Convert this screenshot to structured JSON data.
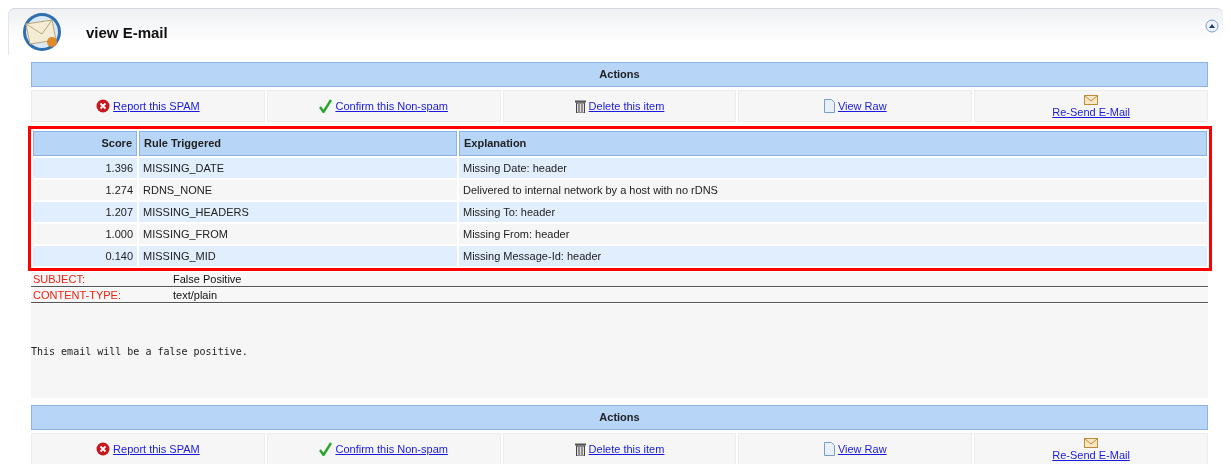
{
  "header": {
    "title": "view E-mail"
  },
  "actions_top": {
    "title": "Actions",
    "items": [
      {
        "kind": "report",
        "label": "Report this SPAM"
      },
      {
        "kind": "confirm",
        "label": "Confirm this Non-spam"
      },
      {
        "kind": "delete",
        "label": "Delete this item"
      },
      {
        "kind": "raw",
        "label": "View Raw"
      },
      {
        "kind": "resend",
        "label": "Re-Send E-Mail"
      }
    ]
  },
  "rules_table": {
    "highlighted": true,
    "columns": [
      "Score",
      "Rule Triggered",
      "Explanation"
    ],
    "rows": [
      {
        "score": "1.396",
        "rule": "MISSING_DATE",
        "explanation": "Missing Date: header"
      },
      {
        "score": "1.274",
        "rule": "RDNS_NONE",
        "explanation": "Delivered to internal network by a host with no rDNS"
      },
      {
        "score": "1.207",
        "rule": "MISSING_HEADERS",
        "explanation": "Missing To: header"
      },
      {
        "score": "1.000",
        "rule": "MISSING_FROM",
        "explanation": "Missing From: header"
      },
      {
        "score": "0.140",
        "rule": "MISSING_MID",
        "explanation": "Missing Message-Id: header"
      }
    ]
  },
  "headers": [
    {
      "name": "SUBJECT:",
      "value": "False Positive"
    },
    {
      "name": "CONTENT-TYPE:",
      "value": "text/plain"
    }
  ],
  "body": "This email will be a false positive.",
  "actions_bottom": {
    "title": "Actions",
    "items": [
      {
        "kind": "report",
        "label": "Report this SPAM"
      },
      {
        "kind": "confirm",
        "label": "Confirm this Non-spam"
      },
      {
        "kind": "delete",
        "label": "Delete this item"
      },
      {
        "kind": "raw",
        "label": "View Raw"
      },
      {
        "kind": "resend",
        "label": "Re-Send E-Mail"
      }
    ]
  }
}
